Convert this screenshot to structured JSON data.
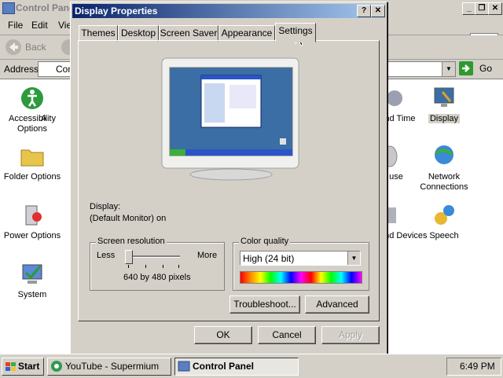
{
  "background_window": {
    "title": "Control Panel",
    "menu": [
      "File",
      "Edit",
      "Vie"
    ],
    "toolbar": {
      "back_label": "Back"
    },
    "address": {
      "label": "Address",
      "value": "Con",
      "go_label": "Go"
    },
    "items": [
      {
        "label": "Accessibility Options",
        "icon": "accessibility-icon"
      },
      {
        "label": "A",
        "icon": "partial-icon"
      },
      {
        "label": "nd Time",
        "icon": "date-time-icon"
      },
      {
        "label": "Display",
        "icon": "display-icon"
      },
      {
        "label": "Folder Options",
        "icon": "folder-icon"
      },
      {
        "label": "use",
        "icon": "mouse-icon"
      },
      {
        "label": "Network Connections",
        "icon": "network-icon"
      },
      {
        "label": "Power Options",
        "icon": "power-icon"
      },
      {
        "label": "s and Devices",
        "icon": "printers-icon"
      },
      {
        "label": "Speech",
        "icon": "speech-icon"
      },
      {
        "label": "System",
        "icon": "system-icon"
      }
    ]
  },
  "dialog": {
    "title": "Display Properties",
    "help_glyph": "?",
    "close_glyph": "✕",
    "tabs": [
      "Themes",
      "Desktop",
      "Screen Saver",
      "Appearance",
      "Settings"
    ],
    "active_tab": "Settings",
    "display_label": "Display:",
    "display_value": "(Default Monitor) on",
    "resolution": {
      "legend": "Screen resolution",
      "less": "Less",
      "more": "More",
      "value_text": "640 by 480 pixels",
      "slider_level": 0
    },
    "color_quality": {
      "legend": "Color quality",
      "selected": "High (24 bit)"
    },
    "troubleshoot_label": "Troubleshoot...",
    "advanced_label": "Advanced",
    "ok_label": "OK",
    "cancel_label": "Cancel",
    "apply_label": "Apply"
  },
  "taskbar": {
    "start_label": "Start",
    "buttons": [
      "YouTube - Supermium",
      "Control Panel"
    ],
    "active_button": "Control Panel",
    "clock": "6:49 PM"
  },
  "colors": {
    "title_active_start": "#0a246a",
    "title_active_end": "#a6caf0",
    "desktop_blue": "#3a6ea5",
    "start_green": "#2e8b2e"
  }
}
